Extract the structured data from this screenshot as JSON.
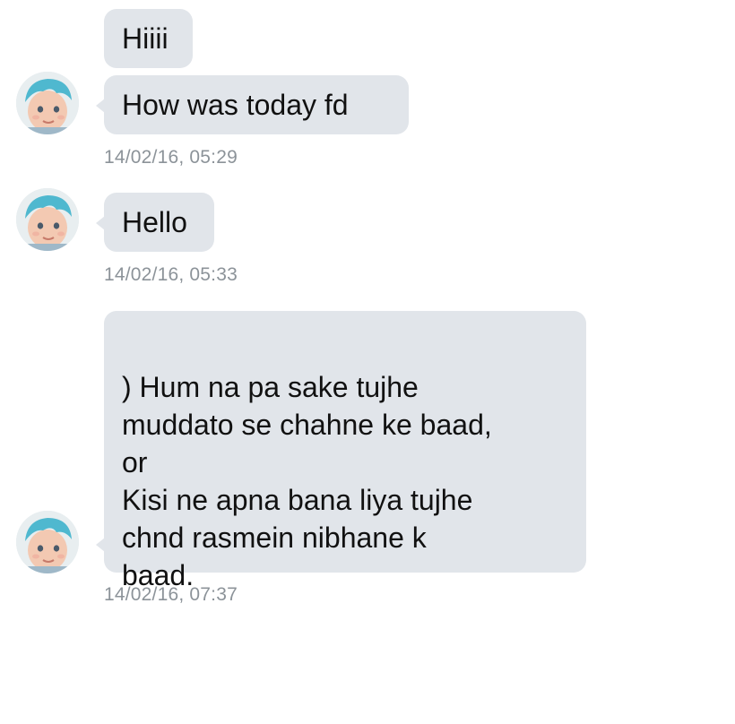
{
  "conversation": {
    "messages": [
      {
        "text": "Hiiii"
      },
      {
        "text": "How was today fd",
        "timestamp": "14/02/16, 05:29"
      },
      {
        "text": "Hello",
        "timestamp": "14/02/16, 05:33"
      },
      {
        "text": ") Hum na pa sake tujhe\nmuddato se chahne ke baad,\nor\nKisi ne apna bana liya tujhe\nchnd rasmein nibhane k\nbaad.",
        "timestamp": "14/02/16, 07:37"
      }
    ]
  },
  "colors": {
    "bubble": "#e1e5ea",
    "timestamp": "#8c9399",
    "hair": "#4fb8cf"
  },
  "icons": {
    "avatar": "avatar-icon"
  }
}
